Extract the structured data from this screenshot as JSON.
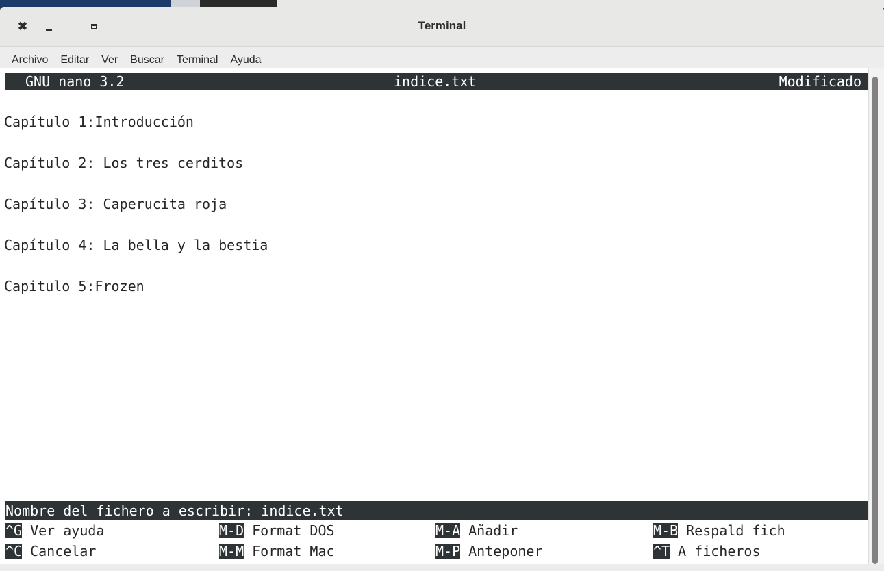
{
  "window": {
    "title": "Terminal",
    "close_glyph": "✖"
  },
  "menubar": {
    "items": [
      "Archivo",
      "Editar",
      "Ver",
      "Buscar",
      "Terminal",
      "Ayuda"
    ]
  },
  "nano": {
    "version": "GNU nano 3.2",
    "filename": "indice.txt",
    "status": "Modificado",
    "lines": [
      "Capítulo 1:Introducción",
      "Capítulo 2: Los tres cerditos",
      "Capítulo 3: Caperucita roja",
      "Capítulo 4: La bella y la bestia",
      "Capitulo 5:Frozen"
    ],
    "prompt": "Nombre del fichero a escribir: indice.txt",
    "shortcuts": [
      [
        {
          "key": "^G",
          "label": "Ver ayuda"
        },
        {
          "key": "M-D",
          "label": "Format DOS"
        },
        {
          "key": "M-A",
          "label": "Añadir"
        },
        {
          "key": "M-B",
          "label": "Respald fich"
        }
      ],
      [
        {
          "key": "^C",
          "label": "Cancelar"
        },
        {
          "key": "M-M",
          "label": "Format Mac"
        },
        {
          "key": "M-P",
          "label": "Anteponer"
        },
        {
          "key": "^T",
          "label": "A ficheros"
        }
      ]
    ]
  },
  "icons": {
    "close": "close-icon",
    "minimize": "minimize-icon",
    "maximize": "maximize-icon"
  },
  "colors": {
    "nano_bar": "#2e3436",
    "terminal_bg": "#ffffff",
    "terminal_fg": "#262626",
    "titlebar": "#e8e8e7"
  }
}
